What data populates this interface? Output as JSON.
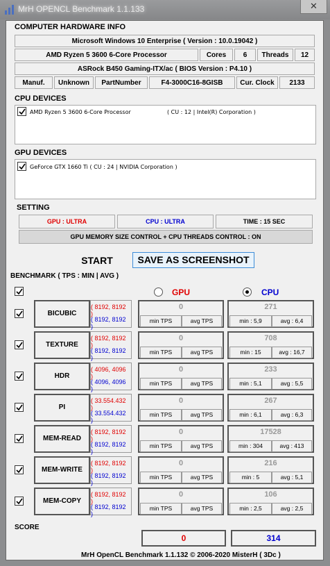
{
  "window": {
    "title": "MrH OPENCL Benchmark 1.1.133",
    "close_glyph": "✕"
  },
  "hardware": {
    "header": "COMPUTER HARDWARE INFO",
    "os": "Microsoft Windows 10 Enterprise ( Version : 10.0.19042 )",
    "cpu_name": "AMD Ryzen 5 3600 6-Core Processor",
    "cores_label": "Cores",
    "cores_value": "6",
    "threads_label": "Threads",
    "threads_value": "12",
    "board": "ASRock B450 Gaming-ITX/ac ( BIOS Version : P4.10 )",
    "manuf_label": "Manuf.",
    "manuf_value": "Unknown",
    "part_label": "PartNumber",
    "part_value": "F4-3000C16-8GISB",
    "clock_label": "Cur. Clock",
    "clock_value": "2133"
  },
  "cpu_devices": {
    "header": "CPU DEVICES",
    "item": "AMD Ryzen 5 3600 6-Core Processor",
    "item_info": "( CU : 12 | Intel(R) Corporation )"
  },
  "gpu_devices": {
    "header": "GPU DEVICES",
    "item": "GeForce GTX 1660 Ti ( CU : 24 | NVIDIA Corporation )"
  },
  "setting": {
    "header": "SETTING",
    "gpu": "GPU : ULTRA",
    "cpu": "CPU : ULTRA",
    "time": "TIME : 15 SEC",
    "control": "GPU MEMORY SIZE CONTROL + CPU THREADS CONTROL : ON"
  },
  "buttons": {
    "start": "START",
    "save": "SAVE AS SCREENSHOT"
  },
  "benchmark": {
    "header": "BENCHMARK ( TPS : MIN | AVG )",
    "gpu_label": "GPU",
    "cpu_label": "CPU",
    "selected": "CPU",
    "rows": [
      {
        "name": "BICUBIC",
        "gpu_size": "( 8192, 8192 )",
        "cpu_size": "( 8192, 8192 )",
        "gpu_value": "0",
        "gpu_min": "min TPS",
        "gpu_avg": "avg TPS",
        "cpu_value": "271",
        "cpu_min": "min : 5,9",
        "cpu_avg": "avg : 6,4"
      },
      {
        "name": "TEXTURE",
        "gpu_size": "( 8192, 8192 )",
        "cpu_size": "( 8192, 8192 )",
        "gpu_value": "0",
        "gpu_min": "min TPS",
        "gpu_avg": "avg TPS",
        "cpu_value": "708",
        "cpu_min": "min : 15",
        "cpu_avg": "avg : 16,7"
      },
      {
        "name": "HDR",
        "gpu_size": "( 4096, 4096 )",
        "cpu_size": "( 4096, 4096 )",
        "gpu_value": "0",
        "gpu_min": "min TPS",
        "gpu_avg": "avg TPS",
        "cpu_value": "233",
        "cpu_min": "min : 5,1",
        "cpu_avg": "avg : 5,5"
      },
      {
        "name": "PI",
        "gpu_size": "( 33.554.432 )",
        "cpu_size": "( 33.554.432 )",
        "gpu_value": "0",
        "gpu_min": "min TPS",
        "gpu_avg": "avg TPS",
        "cpu_value": "267",
        "cpu_min": "min : 6,1",
        "cpu_avg": "avg : 6,3"
      },
      {
        "name": "MEM-READ",
        "gpu_size": "( 8192, 8192 )",
        "cpu_size": "( 8192, 8192 )",
        "gpu_value": "0",
        "gpu_min": "min TPS",
        "gpu_avg": "avg TPS",
        "cpu_value": "17528",
        "cpu_min": "min : 304",
        "cpu_avg": "avg : 413"
      },
      {
        "name": "MEM-WRITE",
        "gpu_size": "( 8192, 8192 )",
        "cpu_size": "( 8192, 8192 )",
        "gpu_value": "0",
        "gpu_min": "min TPS",
        "gpu_avg": "avg TPS",
        "cpu_value": "216",
        "cpu_min": "min : 5",
        "cpu_avg": "avg : 5,1"
      },
      {
        "name": "MEM-COPY",
        "gpu_size": "( 8192, 8192 )",
        "cpu_size": "( 8192, 8192 )",
        "gpu_value": "0",
        "gpu_min": "min TPS",
        "gpu_avg": "avg TPS",
        "cpu_value": "106",
        "cpu_min": "min : 2,5",
        "cpu_avg": "avg : 2,5"
      }
    ]
  },
  "score": {
    "header": "SCORE",
    "gpu": "0",
    "cpu": "314"
  },
  "footer": "MrH OpenCL Benchmark 1.1.132  ©  2006-2020 MisterH ( 3Dc )"
}
